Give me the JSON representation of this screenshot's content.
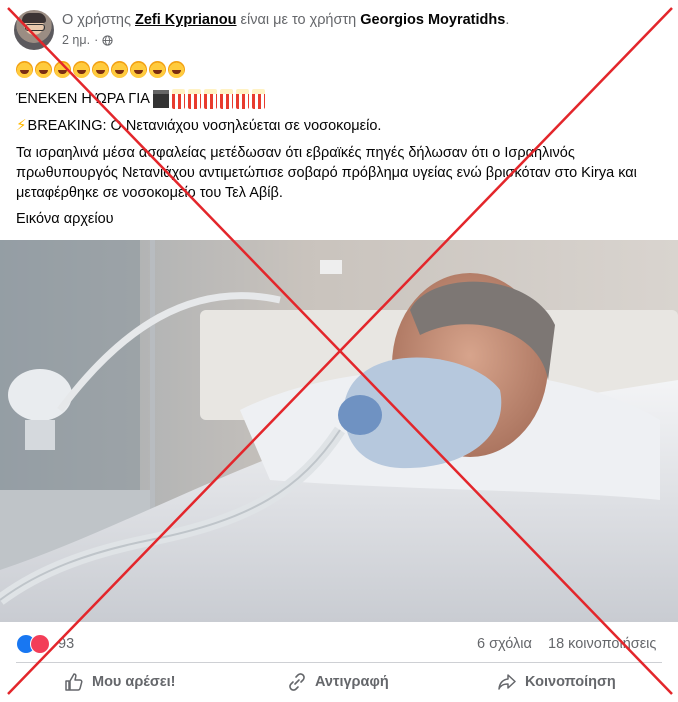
{
  "post": {
    "author": "Zefi Kyprianou",
    "prefix": "Ο χρήστης",
    "connector": "είναι με το χρήστη",
    "tagged": "Georgios Moyratidhs",
    "tagged_suffix": ".",
    "time": "2 ημ.",
    "time_sep": "·",
    "privacy_icon": "globe-icon",
    "line2_text": "ΈΝΕΚΕΝ Η ΏΡΑ ΓΙΑ",
    "line3_text": "BREAKING: Ο Νετανιάχου νοσηλεύεται σε νοσοκομείο.",
    "paragraph": "Τα ισραηλινά μέσα ασφαλείας μετέδωσαν ότι εβραϊκές πηγές δήλωσαν ότι ο Ισραηλινός πρωθυπουργός Νετανιάχου αντιμετώπισε σοβαρό πρόβλημα υγείας ενώ βρισκόταν στο Kirya και μεταφέρθηκε σε νοσοκομείο του Τελ Αβίβ.",
    "caption": "Εικόνα αρχείου"
  },
  "stats": {
    "reactions": "93",
    "comments": "6 σχόλια",
    "shares": "18 κοινοποιήσεις"
  },
  "actions": {
    "like": "Μου αρέσει!",
    "copy": "Αντιγραφή",
    "share": "Κοινοποίηση"
  },
  "colors": {
    "cross": "#e3262b",
    "like_blue": "#1877f2",
    "love_red": "#f33e58"
  }
}
